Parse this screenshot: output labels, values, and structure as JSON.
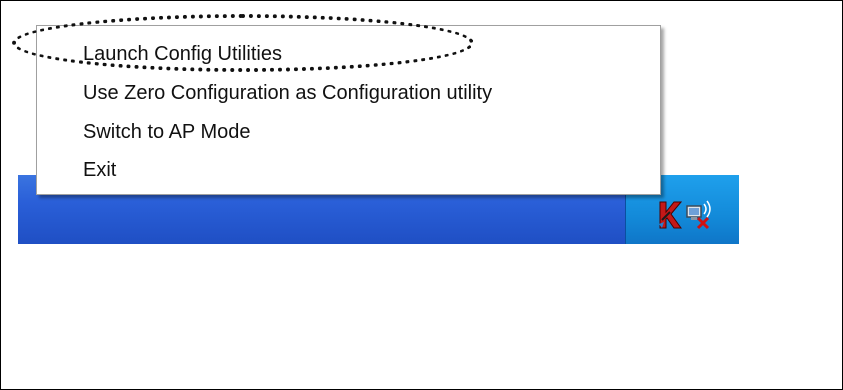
{
  "context_menu": {
    "items": [
      {
        "label": "Launch Config Utilities"
      },
      {
        "label": "Use Zero Configuration as Configuration utility"
      },
      {
        "label": "Switch to AP Mode"
      },
      {
        "label": "Exit"
      }
    ]
  },
  "taskbar": {
    "color": "#2a5fd8",
    "tray_color": "#138ad9",
    "tray_icons": [
      {
        "icon": "wireless-utility-k-icon"
      },
      {
        "icon": "wireless-network-disconnected-icon"
      }
    ]
  },
  "annotation": {
    "type": "dotted-oval",
    "highlights": "Launch Config Utilities"
  }
}
